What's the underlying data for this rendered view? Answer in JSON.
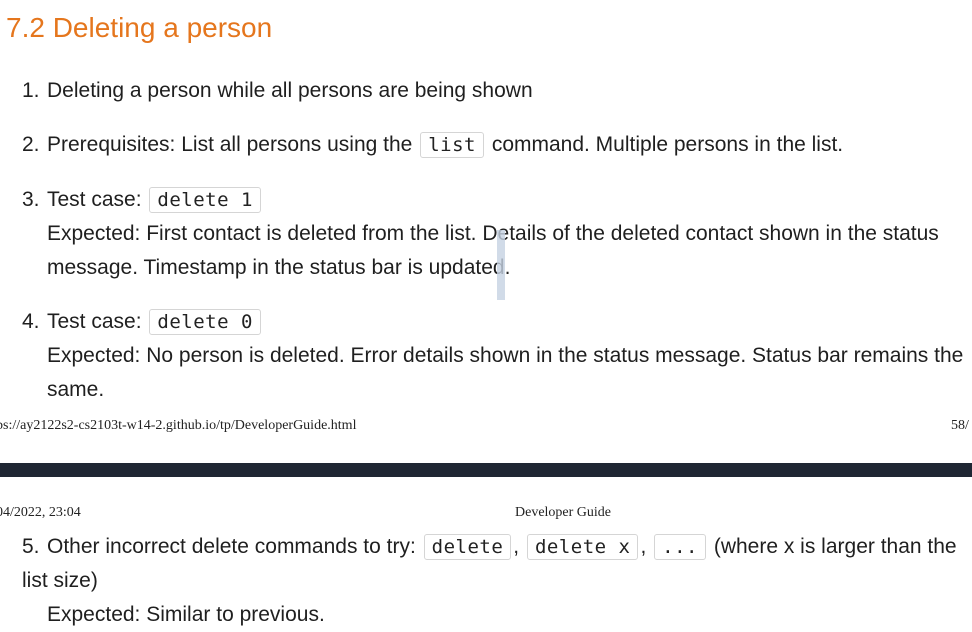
{
  "heading": "7.2 Deleting a person",
  "items": [
    {
      "number": "1.",
      "text": "Deleting a person while all persons are being shown"
    },
    {
      "number": "2.",
      "text_before": "Prerequisites: List all persons using the",
      "code": "list",
      "text_after": "command. Multiple persons in the list."
    },
    {
      "number": "3.",
      "label": "Test case:",
      "code": "delete 1",
      "expected": "Expected: First contact is deleted from the list. Details of the deleted contact shown in the status message. Timestamp in the status bar is updated."
    },
    {
      "number": "4.",
      "label": "Test case:",
      "code": "delete 0",
      "expected": "Expected: No person is deleted. Error details shown in the status message. Status bar remains the same."
    },
    {
      "number": "5.",
      "text_before": "Other incorrect delete commands to try:",
      "codes": [
        "delete",
        "delete x",
        "..."
      ],
      "text_after": "(where x is larger than the list size)",
      "expected": "Expected: Similar to previous."
    }
  ],
  "page_footer": {
    "url": "ps://ay2122s2-cs2103t-w14-2.github.io/tp/DeveloperGuide.html",
    "page": "58/"
  },
  "page_header": {
    "date": "04/2022, 23:04",
    "title": "Developer Guide"
  }
}
